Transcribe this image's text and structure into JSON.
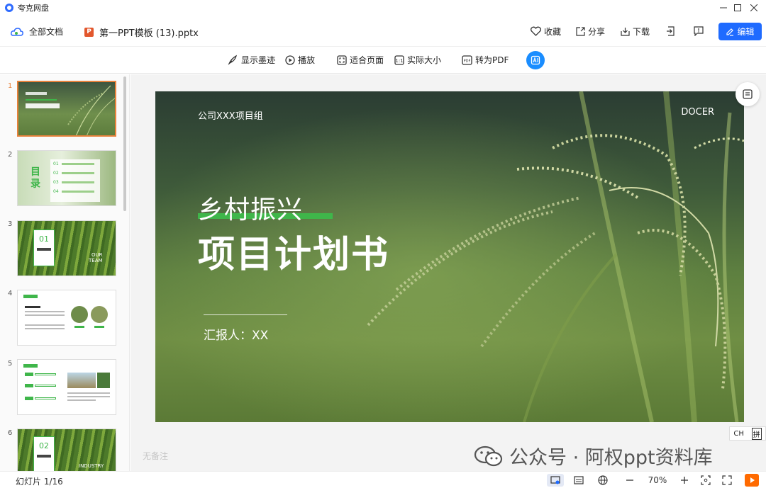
{
  "window": {
    "app_title": "夸克网盘"
  },
  "header": {
    "breadcrumb_root": "全部文档",
    "file_badge": "P",
    "file_name": "第一PPT模板 (13).pptx",
    "actions": {
      "favorite": "收藏",
      "share": "分享",
      "download": "下载",
      "edit": "编辑"
    }
  },
  "toolbar": {
    "ink": "显示墨迹",
    "play": "播放",
    "fit_page": "适合页面",
    "actual_size": "实际大小",
    "to_pdf": "转为PDF"
  },
  "thumbnails": [
    {
      "num": "1",
      "selected": true
    },
    {
      "num": "2",
      "big_text": "目\n录",
      "items": [
        "01",
        "02",
        "03",
        "04"
      ]
    },
    {
      "num": "3",
      "box_num": "01",
      "side_text": "OUR\nTEAM"
    },
    {
      "num": "4"
    },
    {
      "num": "5"
    },
    {
      "num": "6",
      "box_num": "02",
      "side_text": "INDUSTRY"
    }
  ],
  "slide": {
    "company": "公司XXX项目组",
    "brand": "DOCER",
    "title_line1": "乡村振兴",
    "title_line2": "项目计划书",
    "reporter": "汇报人：XX"
  },
  "notes_placeholder": "无备注",
  "ime": {
    "lang": "CH",
    "mode": "拼"
  },
  "watermark": "公众号 · 阿权ppt资料库",
  "status": {
    "slide_count": "幻灯片 1/16",
    "zoom": "70%"
  },
  "colors": {
    "accent": "#1f6bff",
    "selection": "#e8823c",
    "slide_green": "#3fb64a"
  }
}
